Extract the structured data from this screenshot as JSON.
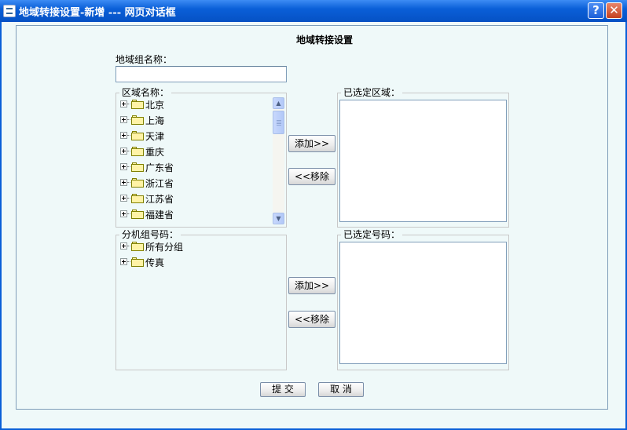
{
  "window": {
    "title": "地域转接设置-新增 --- 网页对话框",
    "help_label": "?",
    "close_label": "✕"
  },
  "form": {
    "heading": "地域转接设置",
    "group_name_label": "地域组名称：",
    "group_name_value": "",
    "region_label": "区域名称：",
    "regions": [
      "北京",
      "上海",
      "天津",
      "重庆",
      "广东省",
      "浙江省",
      "江苏省",
      "福建省"
    ],
    "selected_region_label": "已选定区域：",
    "ext_group_label": "分机组号码：",
    "ext_groups": [
      "所有分组",
      "传真"
    ],
    "selected_number_label": "已选定号码：",
    "add_label": "添加>>",
    "remove_label": "<<移除",
    "submit_label": "提 交",
    "cancel_label": "取 消"
  }
}
